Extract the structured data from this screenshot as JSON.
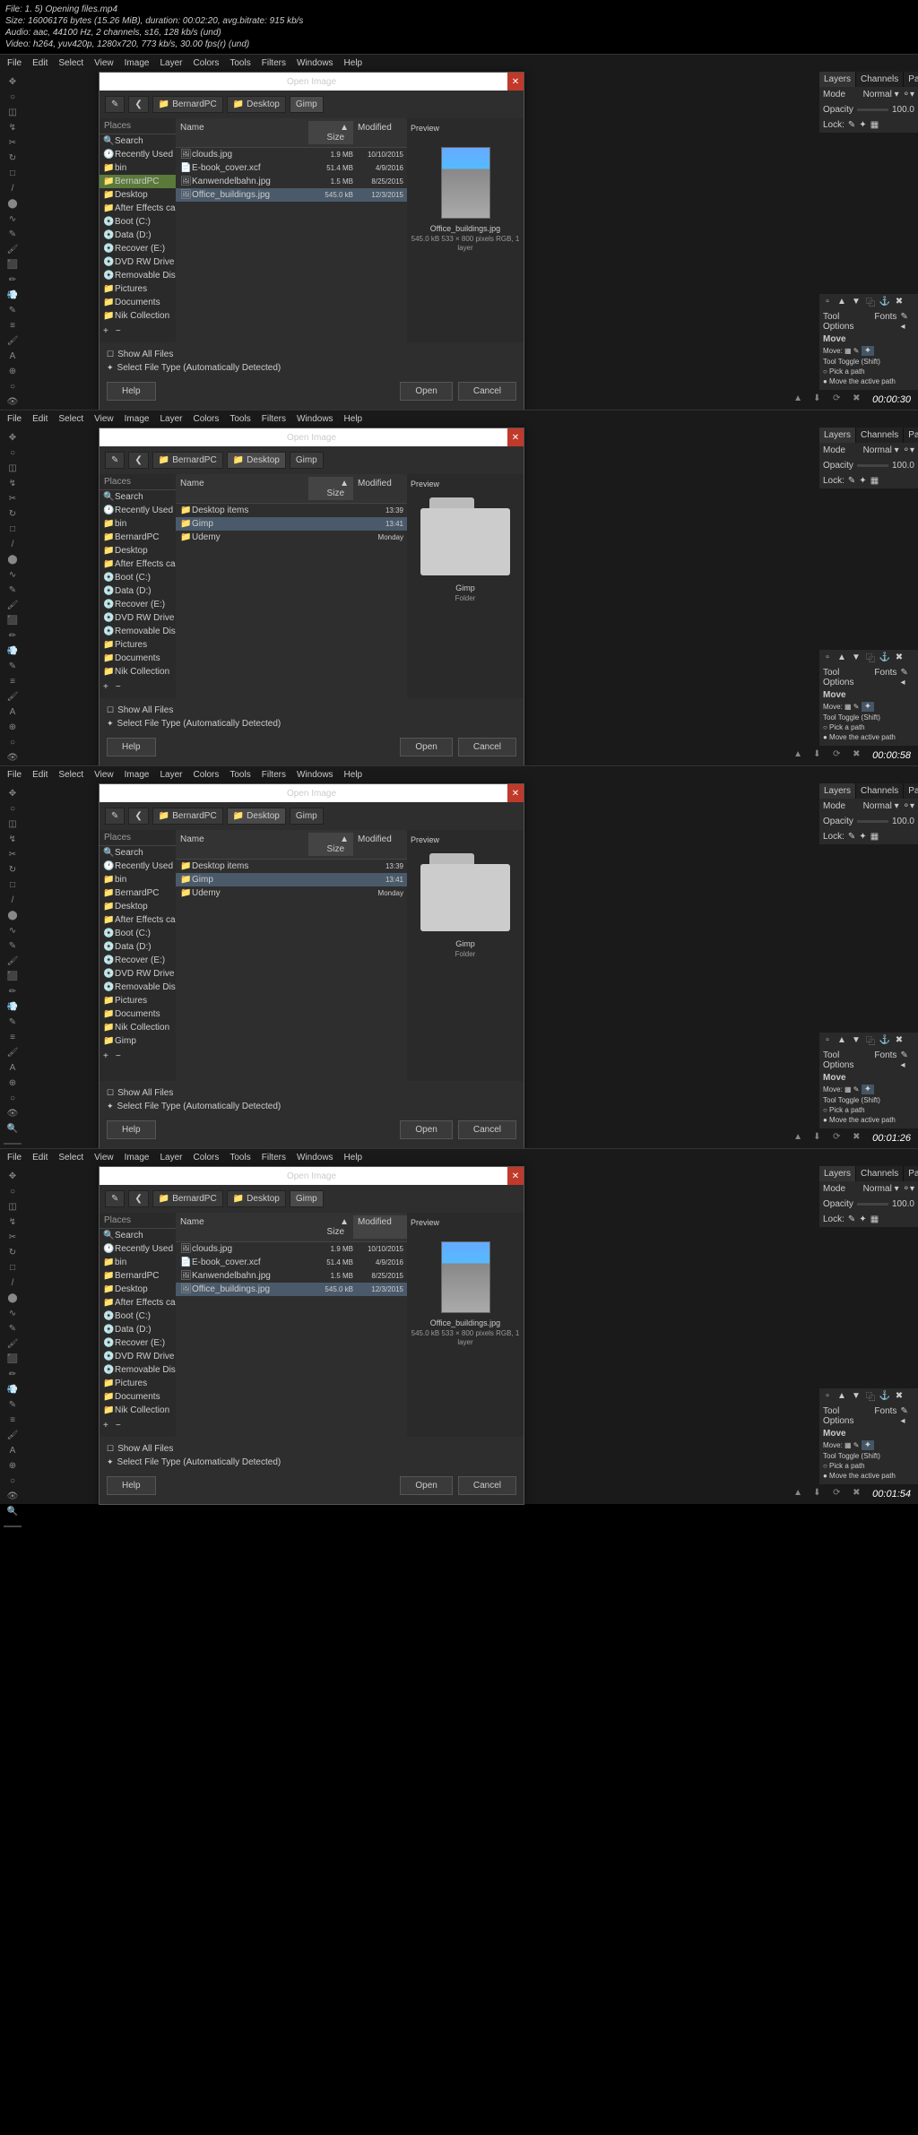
{
  "header": {
    "line1": "File: 1. 5) Opening files.mp4",
    "line2": "Size: 16006176 bytes (15.26 MiB), duration: 00:02:20, avg.bitrate: 915 kb/s",
    "line3": "Audio: aac, 44100 Hz, 2 channels, s16, 128 kb/s (und)",
    "line4": "Video: h264, yuv420p, 1280x720, 773 kb/s, 30.00 fps(r) (und)"
  },
  "menubar": [
    "File",
    "Edit",
    "Select",
    "View",
    "Image",
    "Layer",
    "Colors",
    "Tools",
    "Filters",
    "Windows",
    "Help"
  ],
  "right_panel": {
    "tabs": [
      "Layers",
      "Channels",
      "Paths"
    ],
    "mode_label": "Mode",
    "mode_value": "Normal",
    "opacity_label": "Opacity",
    "opacity_value": "100.0",
    "lock_label": "Lock:",
    "tool_options": {
      "title_tabs": [
        "Tool Options",
        "Fonts"
      ],
      "tool_name": "Move",
      "move_label": "Move:",
      "toggle_label": "Tool Toggle  (Shift)",
      "r1": "Pick a path",
      "r2": "Move the active path"
    }
  },
  "dialog_title": "Open Image",
  "breadcrumb_items": {
    "bernard": "BernardPC",
    "desktop": "Desktop",
    "gimp": "Gimp"
  },
  "places_header": "Places",
  "places": [
    {
      "icon": "🔍",
      "label": "Search"
    },
    {
      "icon": "🕐",
      "label": "Recently Used"
    },
    {
      "icon": "📁",
      "label": "bin"
    },
    {
      "icon": "📁",
      "label": "BernardPC"
    },
    {
      "icon": "📁",
      "label": "Desktop"
    },
    {
      "icon": "📁",
      "label": "After Effects cac..."
    },
    {
      "icon": "💿",
      "label": "Boot (C:)"
    },
    {
      "icon": "💿",
      "label": "Data (D:)"
    },
    {
      "icon": "💿",
      "label": "Recover (E:)"
    },
    {
      "icon": "💿",
      "label": "DVD RW Drive (G:)"
    },
    {
      "icon": "💿",
      "label": "Removable Disk ..."
    },
    {
      "icon": "📁",
      "label": "Pictures"
    },
    {
      "icon": "📁",
      "label": "Documents"
    },
    {
      "icon": "📁",
      "label": "Nik Collection"
    }
  ],
  "gimp_place": {
    "icon": "📁",
    "label": "Gimp"
  },
  "file_headers": {
    "name": "Name",
    "size": "Size",
    "modified": "Modified"
  },
  "preview_header": "Preview",
  "shot1": {
    "files": [
      {
        "icon": "🖼",
        "name": "clouds.jpg",
        "size": "1.9 MB",
        "mod": "10/10/2015"
      },
      {
        "icon": "📄",
        "name": "E-book_cover.xcf",
        "size": "51.4 MB",
        "mod": "4/9/2016"
      },
      {
        "icon": "🖼",
        "name": "Kanwendelbahn.jpg",
        "size": "1.5 MB",
        "mod": "8/25/2015"
      },
      {
        "icon": "🖼",
        "name": "Office_buildings.jpg",
        "size": "545.0 kB",
        "mod": "12/3/2015"
      }
    ],
    "preview_name": "Office_buildings.jpg",
    "preview_meta": "545.0 kB\n533 × 800 pixels\nRGB, 1 layer",
    "timecode": "00:00:30"
  },
  "shot2": {
    "files": [
      {
        "icon": "📁",
        "name": "Desktop items",
        "size": "",
        "mod": "13:39"
      },
      {
        "icon": "📁",
        "name": "Gimp",
        "size": "",
        "mod": "13:41"
      },
      {
        "icon": "📁",
        "name": "Udemy",
        "size": "",
        "mod": "Monday"
      }
    ],
    "preview_name": "Gimp",
    "preview_meta": "Folder",
    "timecode": "00:00:58"
  },
  "shot3": {
    "timecode": "00:01:26"
  },
  "shot4": {
    "timecode": "00:01:54"
  },
  "footer": {
    "show_all": "Show All Files",
    "select_type": "Select File Type (Automatically Detected)",
    "help": "Help",
    "open": "Open",
    "cancel": "Cancel"
  }
}
